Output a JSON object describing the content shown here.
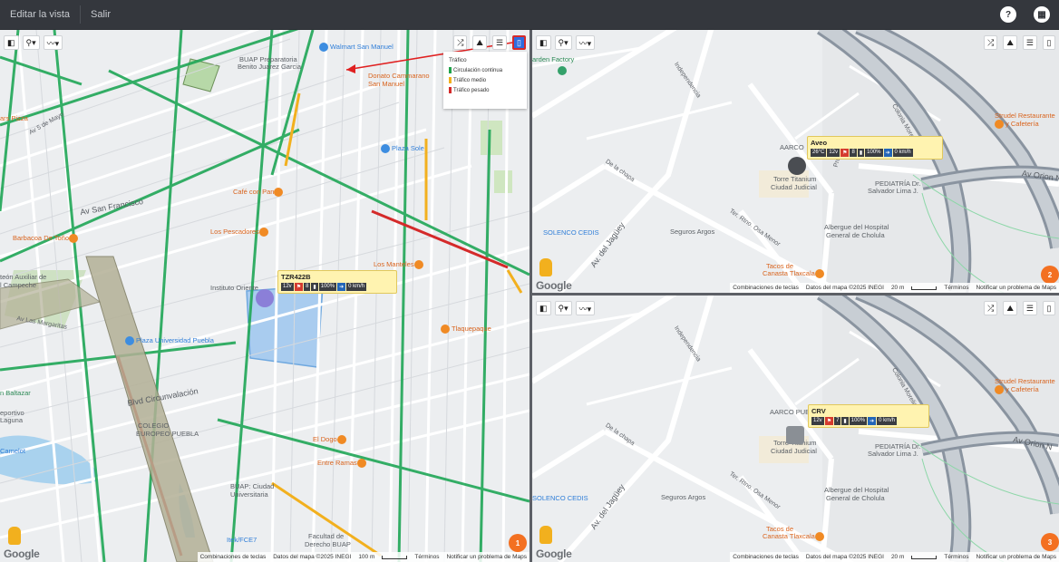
{
  "topbar": {
    "edit_view": "Editar la vista",
    "exit": "Salir"
  },
  "icons": {
    "help": "?",
    "grid": "▦"
  },
  "toolbar": {
    "layers": "◧",
    "marker": "⚲▾",
    "route": "〰▾",
    "shuffle": "⤮",
    "road": "⛰",
    "list": "☰",
    "traffic": "▯"
  },
  "traffic_legend": {
    "title": "Tráfico",
    "items": [
      {
        "label": "Circulación continua",
        "color": "#1fa34a"
      },
      {
        "label": "Tráfico medio",
        "color": "#f2b01e"
      },
      {
        "label": "Tráfico pesado",
        "color": "#d42a2a"
      }
    ]
  },
  "panel1": {
    "vehicle": {
      "name": "TZR422B",
      "chips": [
        "12v",
        "",
        "8",
        "",
        "100%",
        "",
        "0 km/h"
      ]
    },
    "cluster": "1",
    "attribution": {
      "shortcuts": "Combinaciones de teclas",
      "data": "Datos del mapa ©2025 INEGI",
      "scale": "100 m",
      "terms": "Términos",
      "report": "Notificar un problema de Maps"
    },
    "google": "Google",
    "labels": {
      "walmart": "Walmart San Manuel",
      "buap_prep": "BUAP Preparatoria",
      "benito": "Benito Juarez Garcia",
      "donato": "Donato Cammarano",
      "san_manuel": "San Manuel",
      "plaza_sole": "Plaza Sole",
      "stars_pizza": "ars Pizza",
      "cafe_pan": "Café con Pan",
      "pescadores": "Los Pescadores",
      "manteles": "Los Manteles",
      "barbacoa": "Barbacoa De Toño",
      "instituto": "Instituto Oriente",
      "auxiliar": "teón Auxiliar de",
      "campeche": "l Campeche",
      "plaza_univ": "Plaza Universidad Puebla",
      "tlaquepaque": "Tlaquepaque",
      "baltazar": "n Baltazar",
      "deportivo": "eportivo",
      "laguna": "Laguna",
      "camelot": "Camelot",
      "colegio": "COLEGIO",
      "europeo": "EUROPEO PUEBLA",
      "el_dogo": "El Dogo",
      "entre_ramas": "Entre Ramas",
      "buap_ciudad": "BUAP: Ciudad",
      "universitaria": "Universitaria",
      "itek": "Itek/FCE7",
      "facultad": "Facultad de",
      "derecho": "Derecho BUAP",
      "av_san_francisco": "Av San Francisco",
      "blvd_circ": "Blvd Circunvalación",
      "av_mayo": "Av 5 de Mayo",
      "av_margaritas": "Av Las Margaritas"
    }
  },
  "panel2": {
    "vehicle": {
      "name": "Aveo",
      "chips": [
        "26°C",
        "12v",
        "",
        "8",
        "",
        "100%",
        ""
      ]
    },
    "speed": "0 km/h",
    "cluster": "2",
    "attribution": {
      "shortcuts": "Combinaciones de teclas",
      "data": "Datos del mapa ©2025 INEGI",
      "scale": "20 m",
      "terms": "Términos",
      "report": "Notificar un problema de Maps"
    },
    "google": "Google",
    "labels": {
      "garden": "arden Factory",
      "strudel": "Strudel Restaurante",
      "cafeteria": "y Cafetería",
      "aarco": "AARCO",
      "torre": "Torre Titanium",
      "ciudad_judicial": "Ciudad Judicial",
      "pediatria": "PEDIATRÍA Dr.",
      "salvador": "Salvador Lima J.",
      "albergue": "Albergue del Hospital",
      "general": "General de Cholula",
      "solenco": "SOLENCO CEDIS",
      "seguros": "Seguros Argos",
      "tacos": "Tacos de",
      "canasta": "Canasta Tlaxcala",
      "av_orion": "Av Orion N",
      "av_jaguey": "Av. del Jagüey",
      "independencia": "Independencia",
      "de_la_chapa": "De la chapa",
      "privada": "Prol. Ec",
      "ter_rtno": "Ter. Rtno. Osa Menor",
      "colonia": "Colonia Morelia"
    }
  },
  "panel3": {
    "vehicle": {
      "name": "CRV",
      "chips": [
        "12v",
        "",
        "7",
        "",
        "100%",
        "",
        "0 km/h"
      ]
    },
    "cluster": "3",
    "attribution": {
      "shortcuts": "Combinaciones de teclas",
      "data": "Datos del mapa ©2025 INEGI",
      "scale": "20 m",
      "terms": "Términos",
      "report": "Notificar un problema de Maps"
    },
    "google": "Google",
    "labels": {
      "strudel": "Strudel Restaurante",
      "cafeteria": "y Cafetería",
      "aarco": "AARCO PUE",
      "torre": "Torre Titanium",
      "ciudad_judicial": "Ciudad Judicial",
      "pediatria": "PEDIATRÍA Dr.",
      "salvador": "Salvador Lima J.",
      "albergue": "Albergue del Hospital",
      "general": "General de Cholula",
      "solenco": "SOLENCO CEDIS",
      "seguros": "Seguros Argos",
      "tacos": "Tacos de",
      "canasta": "Canasta Tlaxcala",
      "av_orion": "Av Orion N",
      "av_jaguey": "Av. del Jagüey",
      "independencia": "Independencia",
      "de_la_chapa": "De la chapa",
      "ter_rtno": "Ter. Rtno. Osa Menor",
      "colonia": "Colonia Morelia"
    }
  }
}
